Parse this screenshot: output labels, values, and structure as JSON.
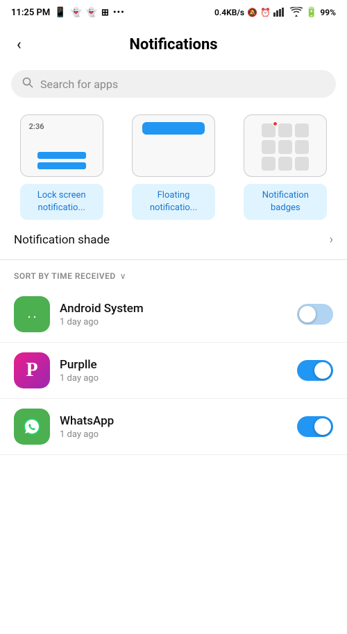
{
  "statusBar": {
    "time": "11:25 PM",
    "network": "0.4KB/s",
    "battery": "99%"
  },
  "header": {
    "back_label": "‹",
    "title": "Notifications"
  },
  "search": {
    "placeholder": "Search for apps"
  },
  "notifTypes": [
    {
      "id": "lock-screen",
      "label": "Lock screen notificatio...",
      "type": "lock"
    },
    {
      "id": "floating",
      "label": "Floating notificatio...",
      "type": "float"
    },
    {
      "id": "badges",
      "label": "Notification badges",
      "type": "badge"
    }
  ],
  "notifShade": {
    "label": "Notification shade"
  },
  "sort": {
    "label": "SORT BY TIME RECEIVED"
  },
  "apps": [
    {
      "name": "Android System",
      "time": "1 day ago",
      "icon_type": "android",
      "enabled": false
    },
    {
      "name": "Purplle",
      "time": "1 day ago",
      "icon_type": "purplle",
      "enabled": true
    },
    {
      "name": "WhatsApp",
      "time": "1 day ago",
      "icon_type": "whatsapp",
      "enabled": true
    }
  ]
}
